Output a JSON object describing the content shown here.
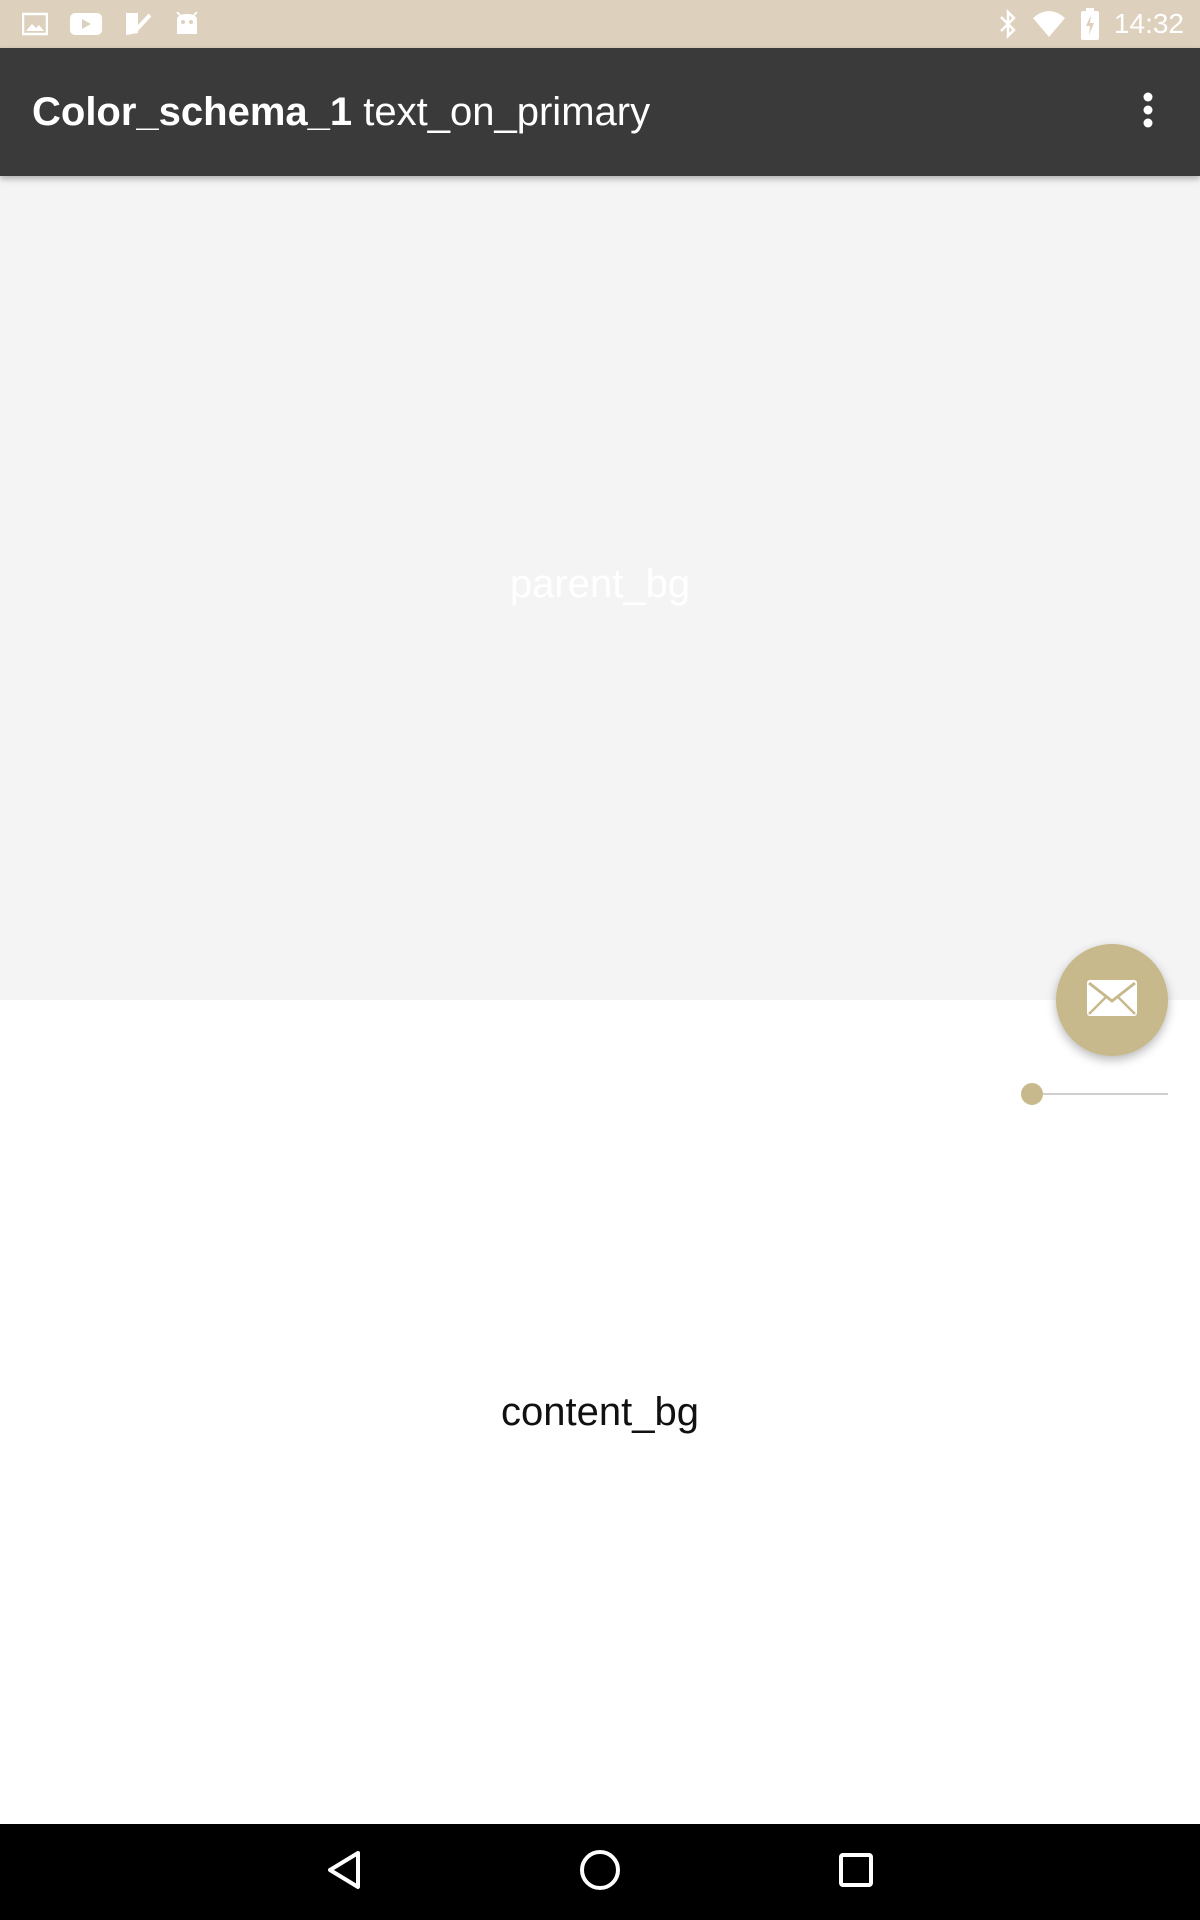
{
  "status_bar": {
    "time": "14:32",
    "left_icons": [
      "gallery-icon",
      "youtube-icon",
      "tasks-icon",
      "android-icon"
    ],
    "right_icons": [
      "bluetooth-icon",
      "wifi-icon",
      "battery-charging-icon"
    ]
  },
  "app_bar": {
    "title_bold": "Color_schema_1",
    "title_rest": "text_on_primary",
    "overflow_icon": "more-vert-icon",
    "background_color": "#3a3a3a"
  },
  "parent_panel": {
    "label": "parent_bg",
    "background_color": "#f4f4f4"
  },
  "content_panel": {
    "label": "content_bg",
    "background_color": "#ffffff"
  },
  "fab": {
    "icon": "mail-icon",
    "color": "#c8b98c"
  },
  "slider": {
    "value": 0,
    "accent_color": "#c8b98c"
  },
  "nav_bar": {
    "buttons": [
      "back-icon",
      "home-icon",
      "recents-icon"
    ]
  }
}
